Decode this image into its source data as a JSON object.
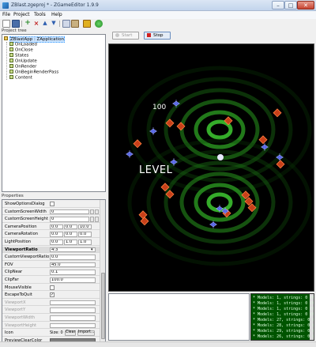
{
  "window": {
    "title": "ZBlast.zgeproj * - ZGameEditor 1.9.9",
    "min": "–",
    "max": "□",
    "close": "✕"
  },
  "menu": {
    "items": [
      "File",
      "Project",
      "Tools",
      "Help"
    ]
  },
  "toolbar": {
    "icons": [
      "new-file-icon",
      "save-icon",
      "add-icon",
      "delete-icon",
      "move-up-icon",
      "move-down-icon",
      "copy-icon",
      "paste-icon",
      "lock-icon",
      "run-icon"
    ]
  },
  "project_tree": {
    "title": "Project tree",
    "items": [
      {
        "label": "ZBlastApp : ZApplication",
        "icon": "application-icon"
      },
      {
        "label": "OnLoaded",
        "icon": "folder-icon"
      },
      {
        "label": "OnClose",
        "icon": "folder-icon"
      },
      {
        "label": "States",
        "icon": "folder-icon"
      },
      {
        "label": "OnUpdate",
        "icon": "folder-icon"
      },
      {
        "label": "OnRender",
        "icon": "folder-icon"
      },
      {
        "label": "OnBeginRenderPass",
        "icon": "folder-icon"
      },
      {
        "label": "Content",
        "icon": "folder-icon"
      }
    ]
  },
  "properties": {
    "title": "Properties",
    "rows": [
      {
        "label": "ShowOptionsDialog",
        "type": "check",
        "checked": false
      },
      {
        "label": "CustomScreenWidth",
        "type": "int",
        "value": "0"
      },
      {
        "label": "CustomScreenHeight",
        "type": "int",
        "value": "0"
      },
      {
        "label": "CameraPosition",
        "type": "vec3",
        "values": [
          "0.0",
          "0.0",
          "10.0"
        ]
      },
      {
        "label": "CameraRotation",
        "type": "vec3",
        "values": [
          "0.0",
          "0.0",
          "0.0"
        ]
      },
      {
        "label": "LightPosition",
        "type": "vec3",
        "values": [
          "0.0",
          "1.0",
          "1.0"
        ]
      },
      {
        "label": "ViewportRatio",
        "type": "select",
        "value": "4:3",
        "section": true
      },
      {
        "label": "CustomViewportRatio",
        "type": "float",
        "value": "0.0"
      },
      {
        "label": "FOV",
        "type": "float",
        "value": "45.0"
      },
      {
        "label": "ClipNear",
        "type": "float",
        "value": "0.1"
      },
      {
        "label": "ClipFar",
        "type": "float",
        "value": "100.0"
      },
      {
        "label": "MouseVisible",
        "type": "check",
        "checked": false
      },
      {
        "label": "EscapeToQuit",
        "type": "check",
        "checked": true
      },
      {
        "label": "ViewportX",
        "type": "float",
        "disabled": true
      },
      {
        "label": "ViewportY",
        "type": "float",
        "disabled": true
      },
      {
        "label": "ViewportWidth",
        "type": "float",
        "disabled": true
      },
      {
        "label": "ViewportHeight",
        "type": "float",
        "disabled": true
      },
      {
        "label": "Icon",
        "type": "icon",
        "size_label": "Size: 0",
        "clear_label": "Clear",
        "import_label": "Import..."
      },
      {
        "label": "PreviewClearColor",
        "type": "color"
      }
    ],
    "check_mark": "✓",
    "select_arrow": "▾"
  },
  "preview": {
    "start_label": "Start",
    "stop_label": "Stop",
    "score": "100",
    "level_text": "LEVEL",
    "colors": {
      "background": "#000000",
      "ring": "#1f8a1a",
      "enemy_red": "#c03010",
      "enemy_blue": "#3040c8"
    }
  },
  "console": {
    "lines": [
      "* Models: 1, strings: 0 (f: 69)",
      "* Models: 1, strings: 0 (f: 69)",
      "* Models: 1, strings: 0 (f: 69)",
      "* Models: 1, strings: 0 (f: 69)",
      "* Models: 27, strings: 0 (f: 13",
      "* Models: 28, strings: 0 (f: 13",
      "* Models: 29, strings: 0 (f: 13",
      "* Models: 26, strings: 0 (f: 13"
    ]
  }
}
